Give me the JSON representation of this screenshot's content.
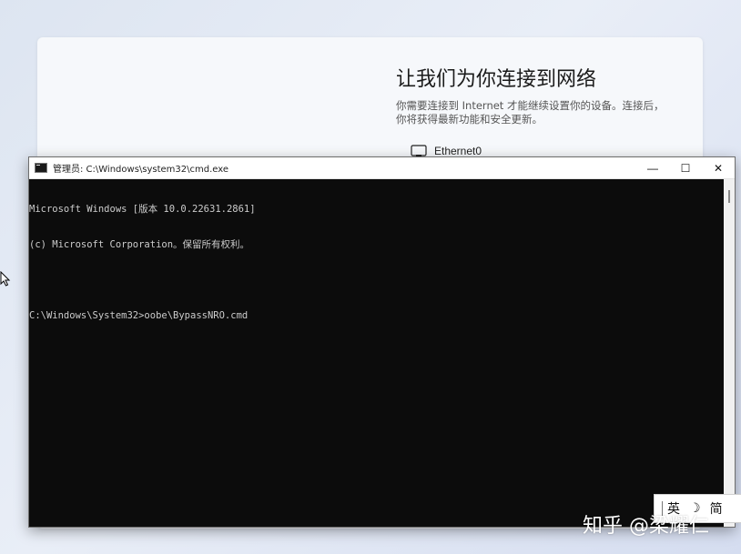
{
  "oobe": {
    "title": "让我们为你连接到网络",
    "description_line1": "你需要连接到 Internet 才能继续设置你的设备。连接后，",
    "description_line2": "你将获得最新功能和安全更新。",
    "network_name": "Ethernet0"
  },
  "cmd_window": {
    "title": "管理员: C:\\Windows\\system32\\cmd.exe",
    "minimize_label": "—",
    "maximize_label": "☐",
    "close_label": "✕",
    "lines": [
      "Microsoft Windows [版本 10.0.22631.2861]",
      "(c) Microsoft Corporation。保留所有权利。",
      "",
      "C:\\Windows\\System32>oobe\\BypassNRO.cmd"
    ]
  },
  "ime": {
    "lang": "英",
    "mode_icon": "☽",
    "script": "简"
  },
  "watermark": "知乎 @梁耀仁",
  "colors": {
    "console_bg": "#0c0c0c",
    "console_text": "#cccccc",
    "titlebar_bg": "#ffffff"
  }
}
